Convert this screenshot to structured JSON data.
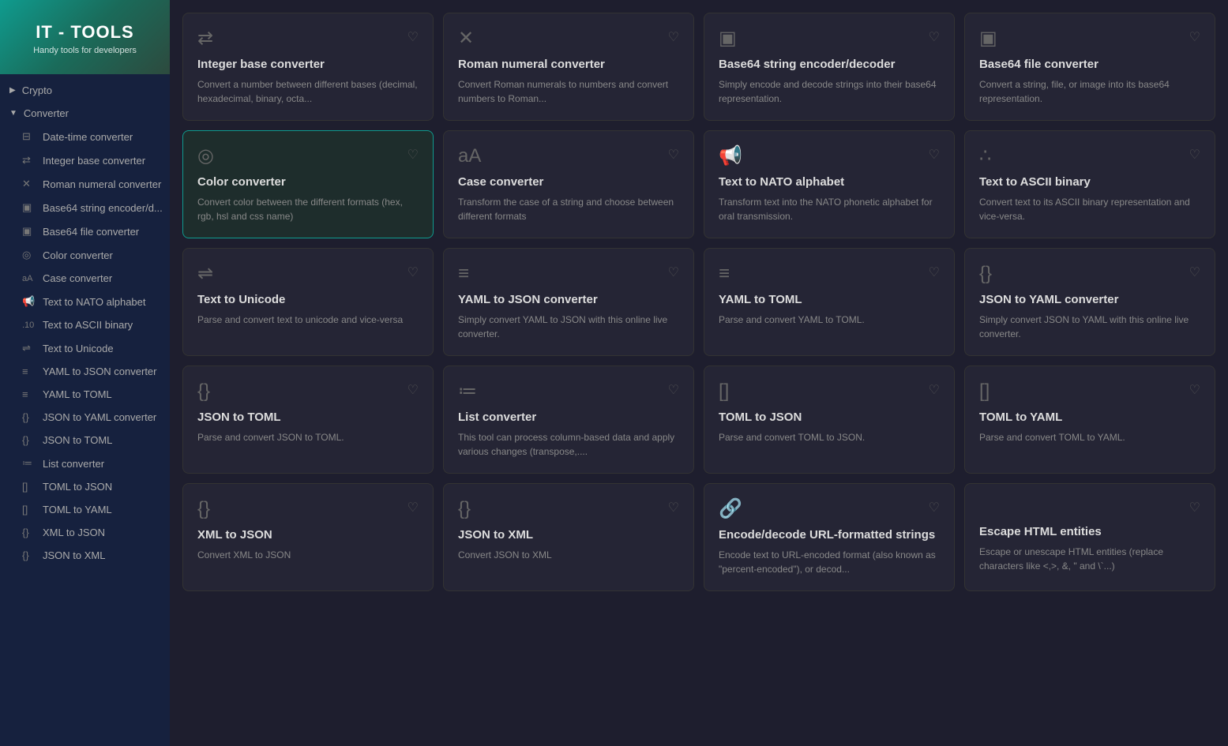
{
  "logo": {
    "title": "IT - TOOLS",
    "subtitle": "Handy tools for developers"
  },
  "sidebar": {
    "categories": [
      {
        "label": "Crypto",
        "collapsed": true,
        "chevron": "▶"
      },
      {
        "label": "Converter",
        "collapsed": false,
        "chevron": "▼",
        "items": [
          {
            "label": "Date-time converter",
            "icon": "⊟"
          },
          {
            "label": "Integer base converter",
            "icon": "⇄"
          },
          {
            "label": "Roman numeral converter",
            "icon": "✕"
          },
          {
            "label": "Base64 string encoder/d...",
            "icon": "▣"
          },
          {
            "label": "Base64 file converter",
            "icon": "▣"
          },
          {
            "label": "Color converter",
            "icon": "◎"
          },
          {
            "label": "Case converter",
            "icon": "aA"
          },
          {
            "label": "Text to NATO alphabet",
            "icon": "📢"
          },
          {
            "label": "Text to ASCII binary",
            "icon": "∴"
          },
          {
            "label": "Text to Unicode",
            "icon": "⇌"
          },
          {
            "label": "YAML to JSON converter",
            "icon": "≡"
          },
          {
            "label": "YAML to TOML",
            "icon": "≡"
          },
          {
            "label": "JSON to YAML converter",
            "icon": "{}"
          },
          {
            "label": "JSON to TOML",
            "icon": "{}"
          },
          {
            "label": "List converter",
            "icon": "≔"
          },
          {
            "label": "TOML to JSON",
            "icon": "[]"
          },
          {
            "label": "TOML to YAML",
            "icon": "[]"
          },
          {
            "label": "XML to JSON",
            "icon": "{}"
          },
          {
            "label": "JSON to XML",
            "icon": "{}"
          }
        ]
      }
    ]
  },
  "cards": [
    {
      "title": "Integer base converter",
      "desc": "Convert a number between different bases (decimal, hexadecimal, binary, octa...",
      "icon": "⇄",
      "highlighted": false
    },
    {
      "title": "Roman numeral converter",
      "desc": "Convert Roman numerals to numbers and convert numbers to Roman...",
      "icon": "✕",
      "highlighted": false
    },
    {
      "title": "Base64 string encoder/decoder",
      "desc": "Simply encode and decode strings into their base64 representation.",
      "icon": "▣",
      "highlighted": false
    },
    {
      "title": "Base64 file converter",
      "desc": "Convert a string, file, or image into its base64 representation.",
      "icon": "▣",
      "highlighted": false
    },
    {
      "title": "Color converter",
      "desc": "Convert color between the different formats (hex, rgb, hsl and css name)",
      "icon": "◎",
      "highlighted": true
    },
    {
      "title": "Case converter",
      "desc": "Transform the case of a string and choose between different formats",
      "icon": "aA",
      "highlighted": false
    },
    {
      "title": "Text to NATO alphabet",
      "desc": "Transform text into the NATO phonetic alphabet for oral transmission.",
      "icon": "📢",
      "highlighted": false
    },
    {
      "title": "Text to ASCII binary",
      "desc": "Convert text to its ASCII binary representation and vice-versa.",
      "icon": "∴",
      "highlighted": false
    },
    {
      "title": "Text to Unicode",
      "desc": "Parse and convert text to unicode and vice-versa",
      "icon": "⇌",
      "highlighted": false
    },
    {
      "title": "YAML to JSON converter",
      "desc": "Simply convert YAML to JSON with this online live converter.",
      "icon": "≡",
      "highlighted": false
    },
    {
      "title": "YAML to TOML",
      "desc": "Parse and convert YAML to TOML.",
      "icon": "≡",
      "highlighted": false
    },
    {
      "title": "JSON to YAML converter",
      "desc": "Simply convert JSON to YAML with this online live converter.",
      "icon": "{}",
      "highlighted": false
    },
    {
      "title": "JSON to TOML",
      "desc": "Parse and convert JSON to TOML.",
      "icon": "{}",
      "highlighted": false
    },
    {
      "title": "List converter",
      "desc": "This tool can process column-based data and apply various changes (transpose,....",
      "icon": "≔",
      "highlighted": false
    },
    {
      "title": "TOML to JSON",
      "desc": "Parse and convert TOML to JSON.",
      "icon": "[]",
      "highlighted": false
    },
    {
      "title": "TOML to YAML",
      "desc": "Parse and convert TOML to YAML.",
      "icon": "[]",
      "highlighted": false
    },
    {
      "title": "XML to JSON",
      "desc": "Convert XML to JSON",
      "icon": "{}",
      "highlighted": false
    },
    {
      "title": "JSON to XML",
      "desc": "Convert JSON to XML",
      "icon": "{}",
      "highlighted": false
    },
    {
      "title": "Encode/decode URL-formatted strings",
      "desc": "Encode text to URL-encoded format (also known as \"percent-encoded\"), or decod...",
      "icon": "🔗",
      "highlighted": false
    },
    {
      "title": "Escape HTML entities",
      "desc": "Escape or unescape HTML entities (replace characters like <,>, &, \" and \\`...)",
      "icon": "</>",
      "highlighted": false
    }
  ]
}
